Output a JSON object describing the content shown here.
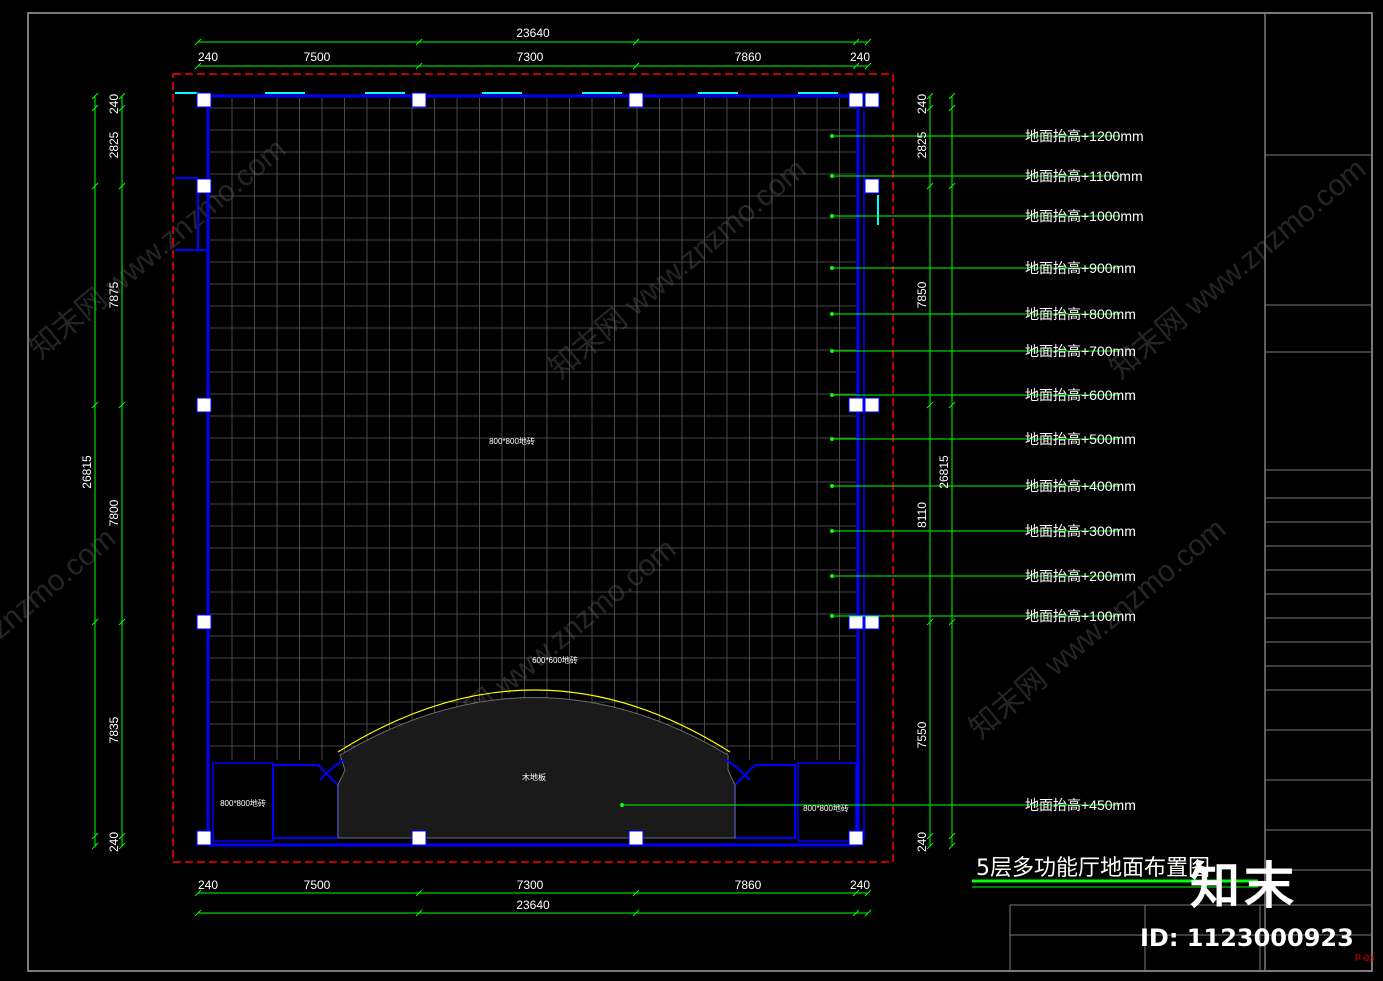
{
  "drawing": {
    "title": "5层多功能厅地面布置图",
    "sheet_no": "P-03",
    "watermark_text": "znzmo.com",
    "watermark_cn": "知末网",
    "logo": "知末",
    "id_label": "ID: 1123000923"
  },
  "dimensions": {
    "top_total": "23640",
    "top_segments": [
      "240",
      "7500",
      "7300",
      "7860",
      "240"
    ],
    "bottom_total": "23640",
    "bottom_segments": [
      "240",
      "7500",
      "7300",
      "7860",
      "240"
    ],
    "left_total": "26815",
    "left_segments": [
      "240",
      "2825",
      "7875",
      "7800",
      "7835",
      "240"
    ],
    "right_total": "26815",
    "right_segments": [
      "240",
      "2825",
      "7850",
      "8110",
      "7550",
      "240"
    ]
  },
  "labels": {
    "floor_tile_main": "800*800地砖",
    "floor_tile_lower": "600*600地砖",
    "wood_floor": "木地板",
    "left_tile": "800*800地砖",
    "right_tile": "800*800地砖"
  },
  "elevations": [
    "地面抬高+1200mm",
    "地面抬高+1100mm",
    "地面抬高+1000mm",
    "地面抬高+900mm",
    "地面抬高+800mm",
    "地面抬高+700mm",
    "地面抬高+600mm",
    "地面抬高+500mm",
    "地面抬高+400mm",
    "地面抬高+300mm",
    "地面抬高+200mm",
    "地面抬高+100mm",
    "地面抬高+450mm"
  ],
  "colors": {
    "background": "#000000",
    "dimension": "#00ff00",
    "wall": "#0000ff",
    "boundary": "#ff0000",
    "grid": "#5a5a5a",
    "stage_arc": "#ffff00",
    "window": "#00ffff"
  }
}
